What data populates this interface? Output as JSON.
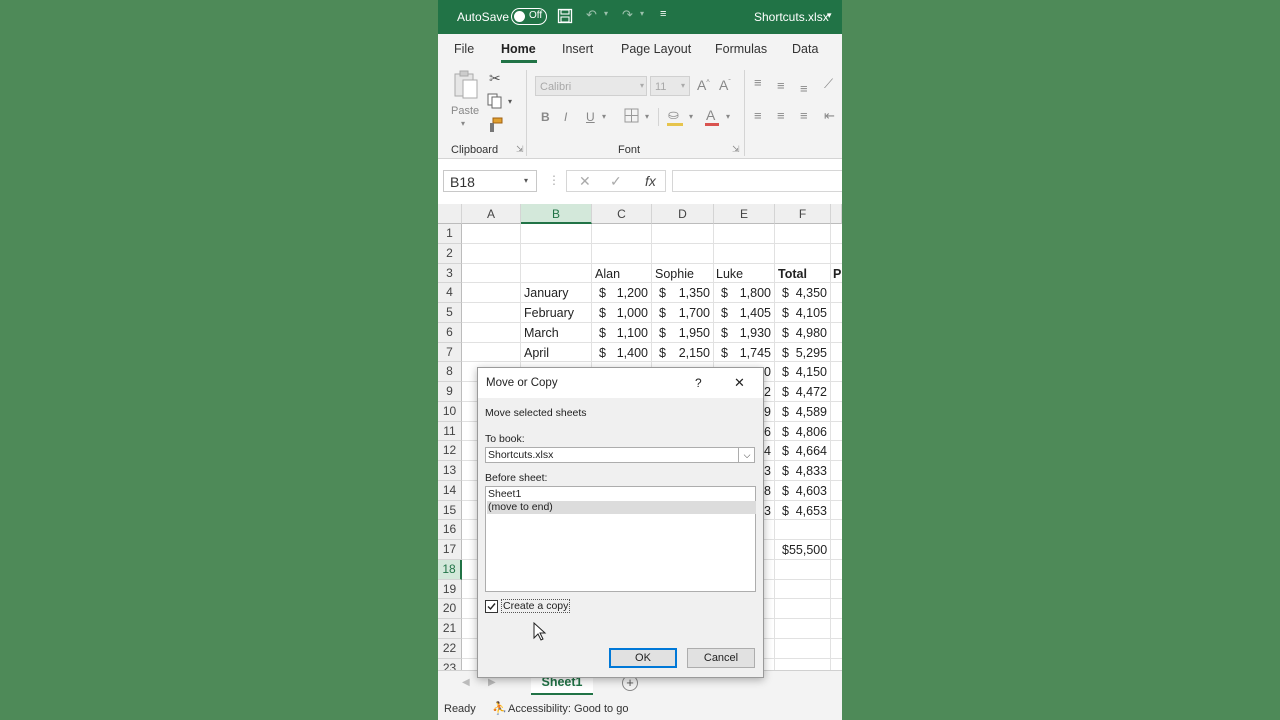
{
  "titlebar": {
    "autosave_label": "AutoSave",
    "toggle_state": "Off",
    "filename": "Shortcuts.xlsx"
  },
  "menu": [
    "File",
    "Home",
    "Insert",
    "Page Layout",
    "Formulas",
    "Data"
  ],
  "ribbon": {
    "paste_label": "Paste",
    "font_name": "Calibri",
    "font_size": "11",
    "clipboard_group": "Clipboard",
    "font_group": "Font",
    "bold": "B",
    "italic": "I",
    "underline": "U"
  },
  "formula_bar": {
    "name_box": "B18",
    "cancel": "✕",
    "enter": "✓",
    "fx": "fx",
    "value": ""
  },
  "grid": {
    "columns": [
      "A",
      "B",
      "C",
      "D",
      "E",
      "F"
    ],
    "selected_column": "B",
    "selected_row": "18",
    "rows": [
      "1",
      "2",
      "3",
      "4",
      "5",
      "6",
      "7",
      "8",
      "9",
      "10",
      "11",
      "12",
      "13",
      "14",
      "15",
      "16",
      "17",
      "18",
      "19",
      "20",
      "21",
      "22",
      "23"
    ],
    "headers": {
      "alan": "Alan",
      "sophie": "Sophie",
      "luke": "Luke",
      "total": "Total",
      "partial_g": "P"
    },
    "months": [
      "January",
      "February",
      "March",
      "April"
    ],
    "alan": [
      "1,200",
      "1,000",
      "1,100",
      "1,400"
    ],
    "sophie": [
      "1,350",
      "1,700",
      "1,950",
      "2,150"
    ],
    "luke": [
      "1,800",
      "1,405",
      "1,930",
      "1,745"
    ],
    "totals": [
      "4,350",
      "4,105",
      "4,980",
      "5,295",
      "4,150",
      "4,472",
      "4,589",
      "4,806",
      "4,664",
      "4,833",
      "4,603",
      "4,653"
    ],
    "luke_partial": [
      "0",
      "2",
      "9",
      "6",
      "4",
      "3",
      "8",
      "3"
    ],
    "grand_total": "$55,500",
    "currency": "$"
  },
  "sheet_tab": "Sheet1",
  "status": {
    "ready": "Ready",
    "accessibility": "Accessibility: Good to go"
  },
  "dialog": {
    "title": "Move or Copy",
    "help": "?",
    "close": "✕",
    "move_selected": "Move selected sheets",
    "to_book_label": "To book:",
    "to_book_value": "Shortcuts.xlsx",
    "before_sheet_label": "Before sheet:",
    "sheets": [
      "Sheet1",
      "(move to end)"
    ],
    "create_copy": "Create a copy",
    "create_copy_checked": true,
    "ok": "OK",
    "cancel": "Cancel"
  }
}
